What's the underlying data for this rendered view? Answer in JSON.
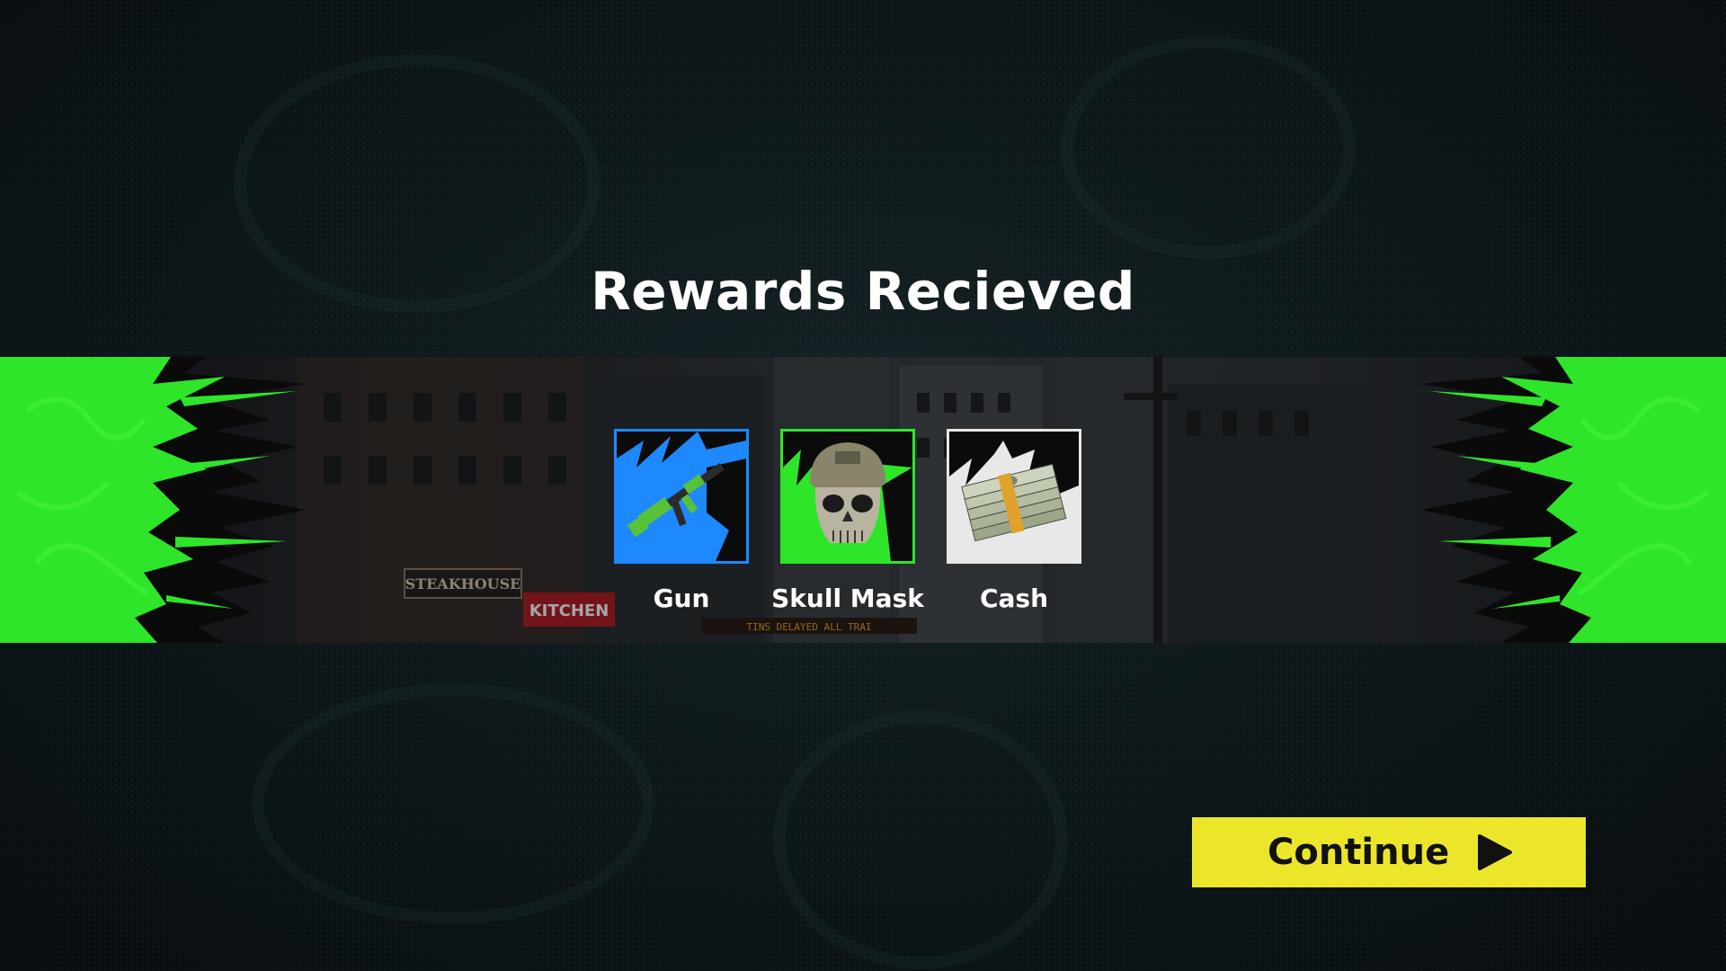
{
  "title": "Rewards Recieved",
  "banner": {
    "accent_color": "#2ee52a",
    "street_signs": [
      "STEAKHOUSE",
      "KITCHEN"
    ],
    "ticker_text": "TINS DELAYED ALL TRAI"
  },
  "rewards": [
    {
      "name": "Gun",
      "icon": "rifle-icon",
      "rarity_color": "#1e88ff"
    },
    {
      "name": "Skull Mask",
      "icon": "skull-mask-icon",
      "rarity_color": "#2ee52a"
    },
    {
      "name": "Cash",
      "icon": "cash-stack-icon",
      "rarity_color": "#e6e6e6"
    }
  ],
  "continue_button": {
    "label": "Continue",
    "icon": "play-icon",
    "color": "#ece62a"
  }
}
